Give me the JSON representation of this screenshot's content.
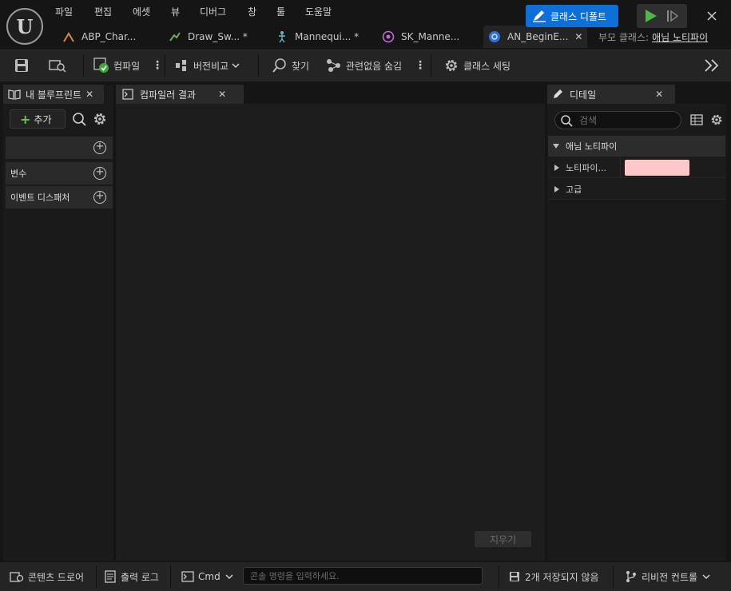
{
  "menu": [
    "파일",
    "편집",
    "에셋",
    "뷰",
    "디버그",
    "창",
    "툴",
    "도움말"
  ],
  "tabs": [
    {
      "label": "ABP_Char...",
      "icon": "anim-blueprint-icon"
    },
    {
      "label": "Draw_Sw... *",
      "icon": "anim-sequence-icon"
    },
    {
      "label": "Mannequi... *",
      "icon": "skeleton-icon"
    },
    {
      "label": "SK_Manne...",
      "icon": "skeletal-mesh-icon"
    },
    {
      "label": "AN_BeginE...",
      "icon": "blueprint-class-icon",
      "active": true
    }
  ],
  "parent_class": {
    "label": "부모 클래스:",
    "value": "애님 노티파이"
  },
  "toolbar": {
    "compile": "컴파일",
    "diff": "버전비교",
    "find": "찾기",
    "hide_unrelated": "관련없음 숨김",
    "class_settings": "클래스 세팅",
    "class_defaults": "클래스 디폴트"
  },
  "left_panel": {
    "tab": "내 블루프린트",
    "add_button": "추가",
    "sections": [
      "",
      "변수",
      "이벤트 디스패처"
    ]
  },
  "center_panel": {
    "tab": "컴파일러 결과",
    "clear_button": "지우기"
  },
  "details": {
    "tab": "디테일",
    "search_placeholder": "검색",
    "category": "애님 노티파이",
    "rows": [
      {
        "label": "노티파이...",
        "color": "#ffc8c8"
      },
      {
        "label": "고급"
      }
    ]
  },
  "statusbar": {
    "content_drawer": "콘텐츠 드로어",
    "output_log": "출력 로그",
    "cmd": "Cmd",
    "console_placeholder": "콘솔 명령을 입력하세요.",
    "unsaved": "2개 저장되지 않음",
    "revision_control": "리비전 컨트롤"
  }
}
